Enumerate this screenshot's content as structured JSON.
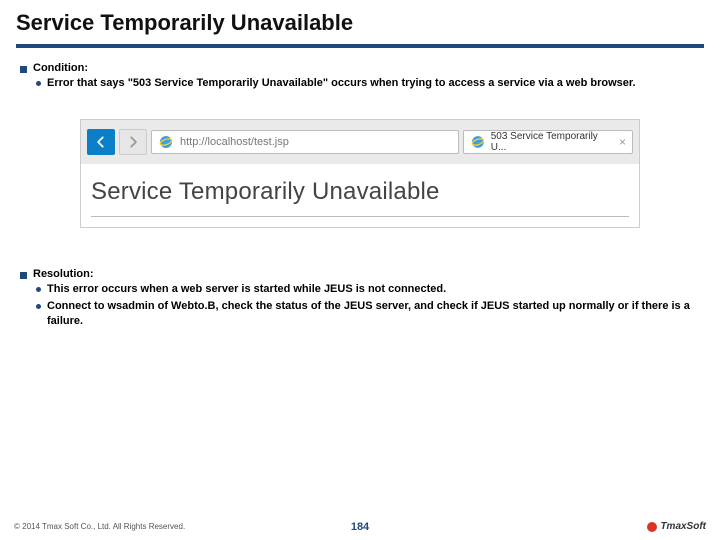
{
  "title": "Service Temporarily Unavailable",
  "condition": {
    "heading": "Condition:",
    "items": [
      "Error that says \"503 Service Temporarily Unavailable\" occurs when trying to access a service via a web browser."
    ]
  },
  "browser": {
    "url": "http://localhost/test.jsp",
    "tab_title": "503 Service Temporarily U...",
    "error_heading": "Service Temporarily Unavailable"
  },
  "resolution": {
    "heading": "Resolution:",
    "items": [
      "This error occurs when a web server is started while JEUS is not connected.",
      "Connect to wsadmin of Webto.B, check the status of the JEUS server, and check if JEUS started up normally or if there is a failure."
    ]
  },
  "footer": {
    "copyright": "© 2014 Tmax Soft Co., Ltd. All Rights Reserved.",
    "page": "184",
    "brand": "TmaxSoft"
  }
}
